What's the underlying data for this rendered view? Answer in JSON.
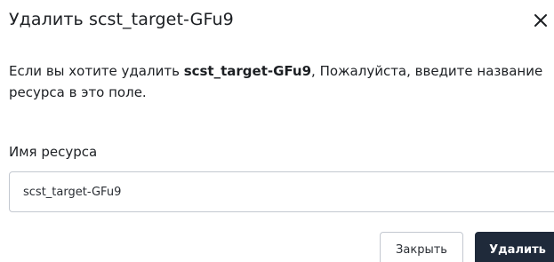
{
  "dialog": {
    "title": "Удалить scst_target-GFu9",
    "close_icon": "close-icon",
    "message": {
      "prefix": "Если вы хотите удалить ",
      "resource_name": "scst_target-GFu9",
      "suffix": ", Пожалуйста, введите название ресурса в это поле."
    },
    "field": {
      "label": "Имя ресурса",
      "value": "scst_target-GFu9"
    },
    "buttons": {
      "close_label": "Закрыть",
      "delete_label": "Удалить"
    }
  }
}
